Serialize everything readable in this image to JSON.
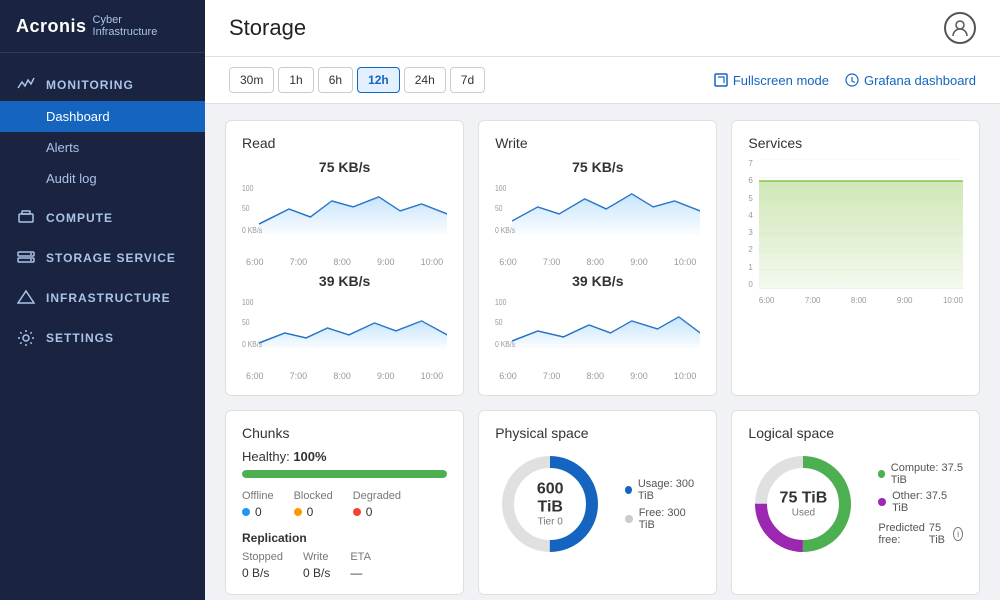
{
  "app": {
    "name": "Acronis",
    "subtitle": "Cyber Infrastructure",
    "user_icon": "⊙"
  },
  "sidebar": {
    "monitoring": {
      "label": "MONITORING",
      "items": [
        {
          "id": "dashboard",
          "label": "Dashboard",
          "active": true
        },
        {
          "id": "alerts",
          "label": "Alerts",
          "active": false
        },
        {
          "id": "audit-log",
          "label": "Audit log",
          "active": false
        }
      ]
    },
    "compute": {
      "label": "COMPUTE"
    },
    "storage_service": {
      "label": "STORAGE SERVICE"
    },
    "infrastructure": {
      "label": "INFRASTRUCTURE"
    },
    "settings": {
      "label": "SETTINGS"
    }
  },
  "page": {
    "title": "Storage"
  },
  "toolbar": {
    "time_buttons": [
      "30m",
      "1h",
      "6h",
      "12h",
      "24h",
      "7d"
    ],
    "active_time": "12h",
    "fullscreen_label": "Fullscreen mode",
    "grafana_label": "Grafana dashboard"
  },
  "cards": {
    "read": {
      "title": "Read",
      "value1": "75 KB/s",
      "value2": "39 KB/s",
      "time_labels": [
        "6:00",
        "7:00",
        "8:00",
        "9:00",
        "10:00"
      ],
      "y_labels1": [
        "100",
        "50",
        "0 KB/s"
      ],
      "y_labels2": [
        "100",
        "50",
        "0 KB/s"
      ]
    },
    "write": {
      "title": "Write",
      "value1": "75 KB/s",
      "value2": "39 KB/s",
      "time_labels": [
        "6:00",
        "7:00",
        "8:00",
        "9:00",
        "10:00"
      ],
      "y_labels1": [
        "100",
        "50",
        "0 KB/s"
      ],
      "y_labels2": [
        "100",
        "50",
        "0 KB/s"
      ]
    },
    "services": {
      "title": "Services",
      "y_labels": [
        "0",
        "1",
        "2",
        "3",
        "4",
        "5",
        "6",
        "7"
      ],
      "time_labels": [
        "6:00",
        "7:00",
        "8:00",
        "9:00",
        "10:00"
      ]
    },
    "chunks": {
      "title": "Chunks",
      "healthy_label": "Healthy:",
      "healthy_value": "100%",
      "progress": 100,
      "offline_label": "Offline",
      "offline_value": "0",
      "blocked_label": "Blocked",
      "blocked_value": "0",
      "degraded_label": "Degraded",
      "degraded_value": "0",
      "replication_label": "Replication",
      "stopped_label": "Stopped",
      "stopped_value": "0 B/s",
      "write_label": "Write",
      "write_value": "0 B/s",
      "eta_label": "ETA",
      "eta_value": "—"
    },
    "physical": {
      "title": "Physical space",
      "center_value": "600 TiB",
      "center_sub": "Tier 0",
      "usage_label": "Usage: 300 TiB",
      "free_label": "Free: 300 TiB"
    },
    "logical": {
      "title": "Logical space",
      "center_value": "75 TiB",
      "center_sub": "Used",
      "compute_label": "Compute:",
      "compute_value": "37.5 TiB",
      "other_label": "Other:",
      "other_value": "37.5 TiB",
      "predicted_label": "Predicted free:",
      "predicted_value": "75 TiB"
    }
  }
}
